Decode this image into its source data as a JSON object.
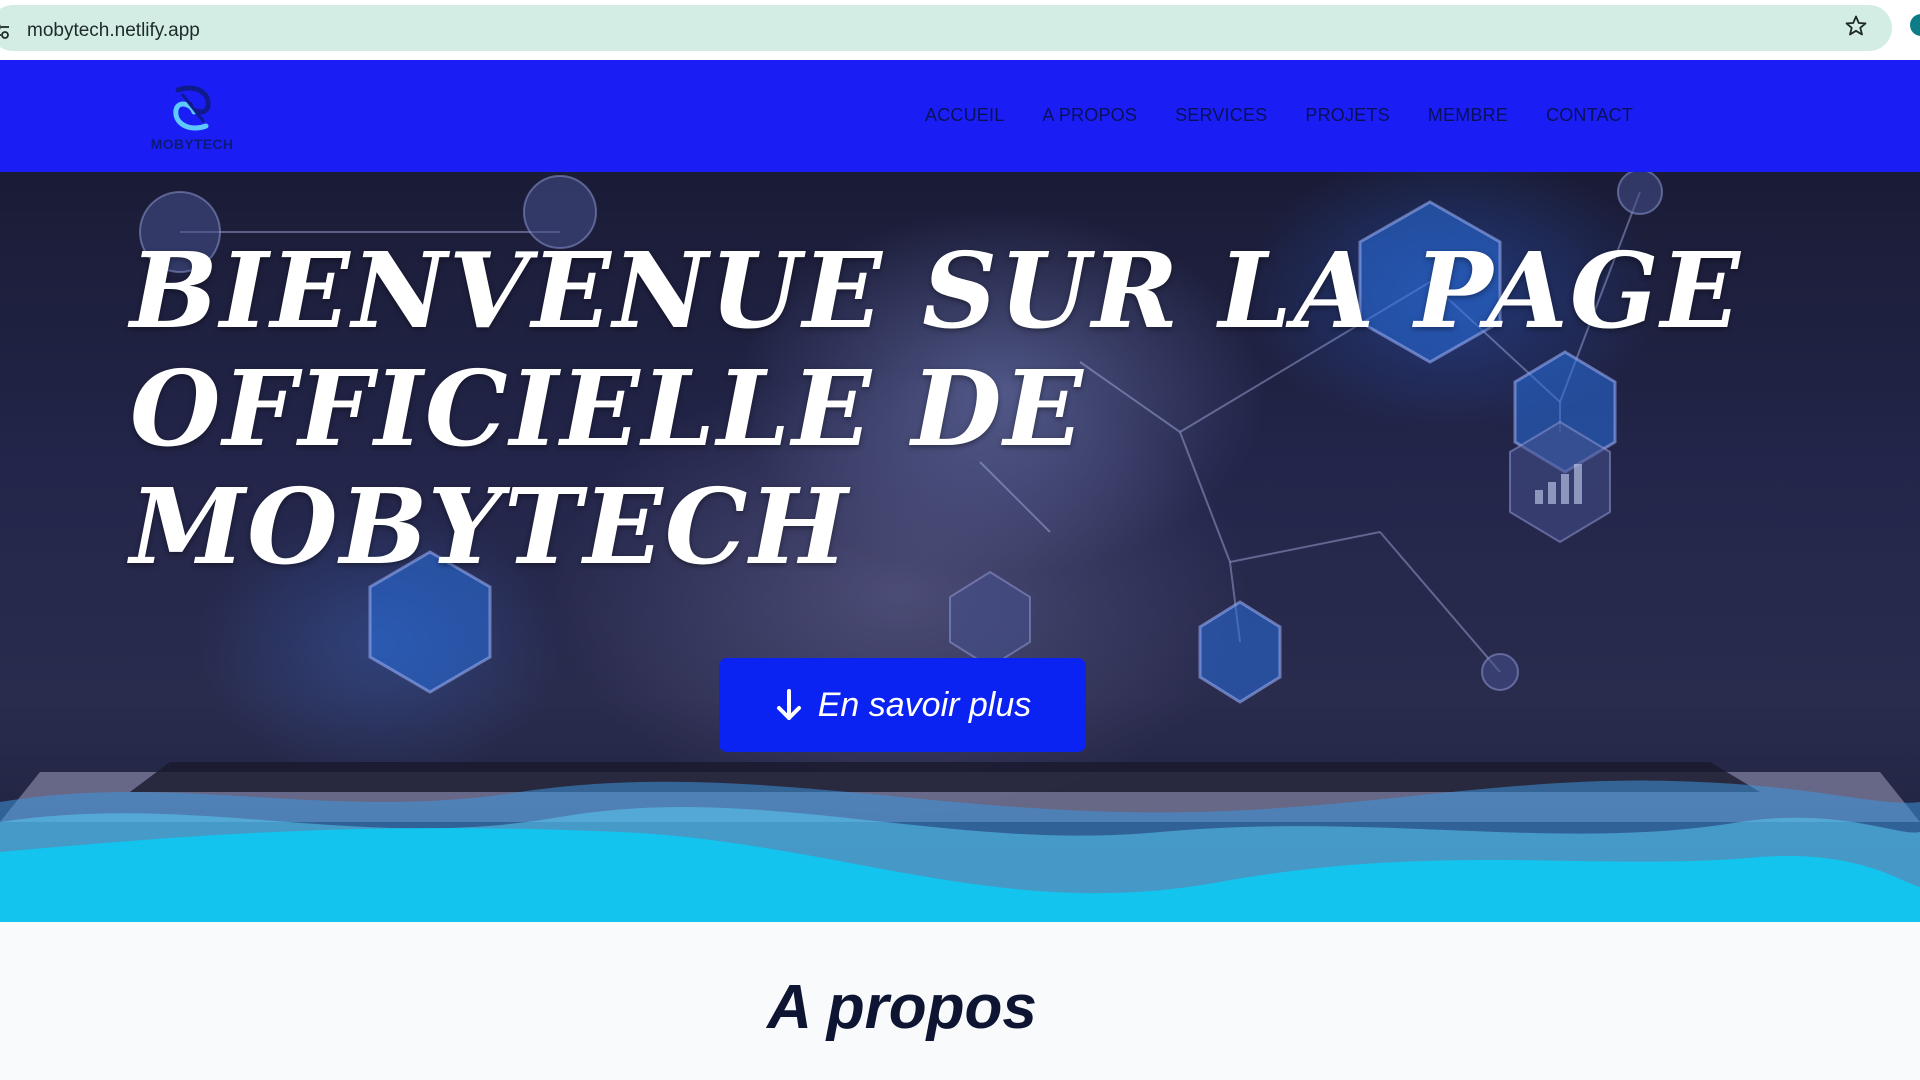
{
  "browser": {
    "url": "mobytech.netlify.app"
  },
  "nav": {
    "logo_text": "MOBYTECH",
    "links": [
      "ACCUEIL",
      "A PROPOS",
      "SERVICES",
      "PROJETS",
      "MEMBRE",
      "CONTACT"
    ]
  },
  "hero": {
    "title": "BIENVENUE SUR LA PAGE OFFICIELLE DE MOBYTECH",
    "cta_label": "En savoir plus"
  },
  "about": {
    "title": "A propos"
  },
  "colors": {
    "nav_bg": "#1a1ef5",
    "cta_bg": "#0a22f2",
    "wave": "#12c4ee",
    "address_bar": "#d3ece4"
  }
}
